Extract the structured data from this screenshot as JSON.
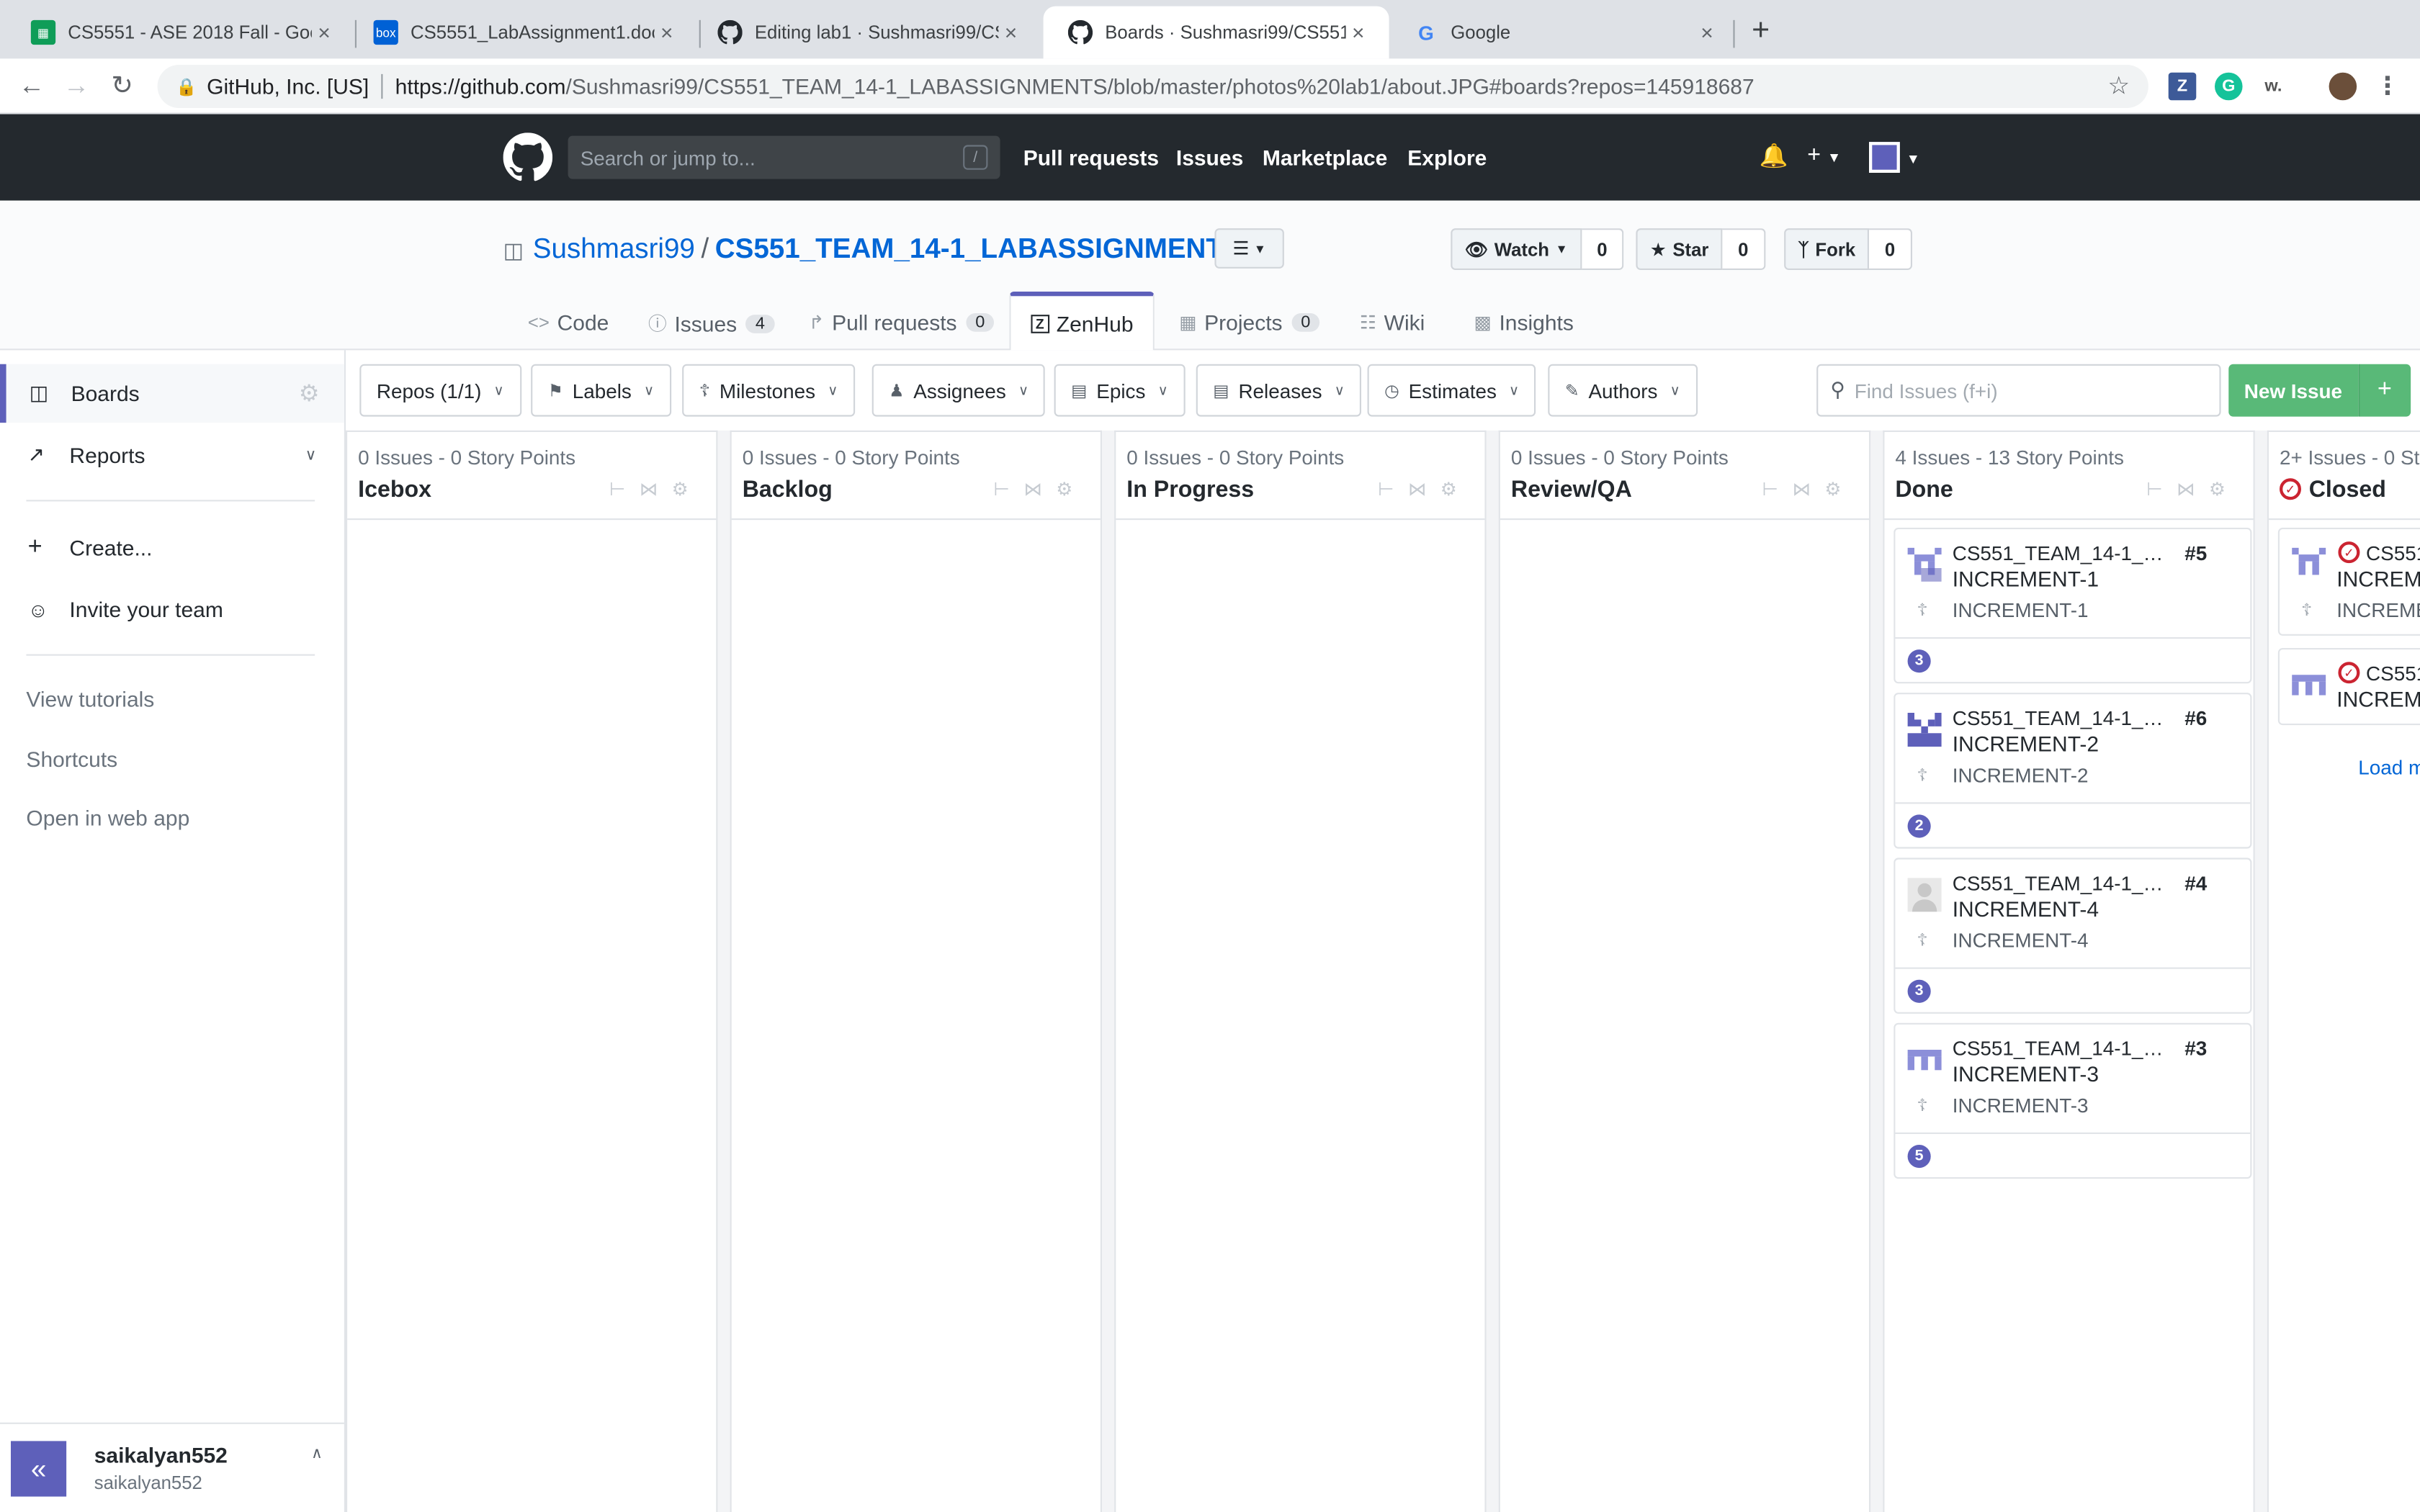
{
  "browser": {
    "tabs": [
      {
        "title": "CS5551 - ASE 2018 Fall - Goog",
        "icon": "sheets-icon",
        "color": "#0f9d58"
      },
      {
        "title": "CS5551_LabAssignment1.docx",
        "icon": "box-icon",
        "color": "#0061d5",
        "badge": "box"
      },
      {
        "title": "Editing lab1 · Sushmasri99/CS5",
        "icon": "github-icon",
        "color": "#24292e"
      },
      {
        "title": "Boards · Sushmasri99/CS551_T",
        "icon": "github-icon",
        "color": "#24292e"
      },
      {
        "title": "Google",
        "icon": "google-icon",
        "color": "#4285f4"
      }
    ],
    "active_tab": 3,
    "site_org": "GitHub, Inc. [US]",
    "url_host": "https://github.com",
    "url_path": "/Sushmasri99/CS551_TEAM_14-1_LABASSIGNMENTS/blob/master/photos%20lab1/about.JPG#boards?repos=145918687",
    "extensions": [
      {
        "label": "Z",
        "color": "#3d5a98"
      },
      {
        "label": "G",
        "color": "#15c39a"
      },
      {
        "label": "w.",
        "color": "#555555"
      }
    ]
  },
  "github": {
    "search_placeholder": "Search or jump to...",
    "search_key": "/",
    "nav": [
      "Pull requests",
      "Issues",
      "Marketplace",
      "Explore"
    ],
    "owner": "Sushmasri99",
    "repo": "CS551_TEAM_14-1_LABASSIGNMENTS",
    "watch": {
      "label": "Watch",
      "count": "0"
    },
    "star": {
      "label": "Star",
      "count": "0"
    },
    "fork": {
      "label": "Fork",
      "count": "0"
    },
    "tabs": [
      {
        "label": "Code",
        "icon": "code-icon"
      },
      {
        "label": "Issues",
        "count": "4",
        "icon": "issue-icon"
      },
      {
        "label": "Pull requests",
        "count": "0",
        "icon": "pr-icon"
      },
      {
        "label": "ZenHub",
        "icon": "zenhub-icon"
      },
      {
        "label": "Projects",
        "count": "0",
        "icon": "project-icon"
      },
      {
        "label": "Wiki",
        "icon": "book-icon"
      },
      {
        "label": "Insights",
        "icon": "graph-icon"
      }
    ]
  },
  "sidebar": {
    "boards": "Boards",
    "reports": "Reports",
    "create": "Create...",
    "invite": "Invite your team",
    "links": [
      "View tutorials",
      "Shortcuts",
      "Open in web app"
    ],
    "user_name": "saikalyan552",
    "user_login": "saikalyan552",
    "collapse": "«"
  },
  "filters": {
    "buttons": [
      "Repos (1/1)",
      "Labels",
      "Milestones",
      "Assignees",
      "Epics",
      "Releases",
      "Estimates",
      "Authors"
    ],
    "find_placeholder": "Find Issues (f+i)",
    "new_issue": "New Issue",
    "plus": "+"
  },
  "board": {
    "accent": "#5e60ba",
    "pipelines": [
      {
        "issues": "0 Issues",
        "points": "0 Story Points",
        "name": "Icebox"
      },
      {
        "issues": "0 Issues",
        "points": "0 Story Points",
        "name": "Backlog"
      },
      {
        "issues": "0 Issues",
        "points": "0 Story Points",
        "name": "In Progress"
      },
      {
        "issues": "0 Issues",
        "points": "0 Story Points",
        "name": "Review/QA"
      },
      {
        "issues": "4 Issues",
        "points": "13 Story Points",
        "name": "Done"
      }
    ],
    "done_cards": [
      {
        "repo": "CS551_TEAM_14-1_LAB...",
        "number": "#5",
        "title": "INCREMENT-1",
        "milestone": "INCREMENT-1",
        "estimate": "3"
      },
      {
        "repo": "CS551_TEAM_14-1_LAB...",
        "number": "#6",
        "title": "INCREMENT-2",
        "milestone": "INCREMENT-2",
        "estimate": "2"
      },
      {
        "repo": "CS551_TEAM_14-1_LAB...",
        "number": "#4",
        "title": "INCREMENT-4",
        "milestone": "INCREMENT-4",
        "estimate": "3"
      },
      {
        "repo": "CS551_TEAM_14-1_LAB...",
        "number": "#3",
        "title": "INCREMENT-3",
        "milestone": "INCREMENT-3",
        "estimate": "5"
      }
    ],
    "closed": {
      "issues": "2+ Issues",
      "points": "0 St",
      "name": "Closed",
      "cards": [
        {
          "repo": "CS551",
          "title": "INCREME",
          "milestone": "INCREMEN"
        },
        {
          "repo": "CS551",
          "title": "INCREME"
        }
      ],
      "load_more": "Load m"
    }
  }
}
